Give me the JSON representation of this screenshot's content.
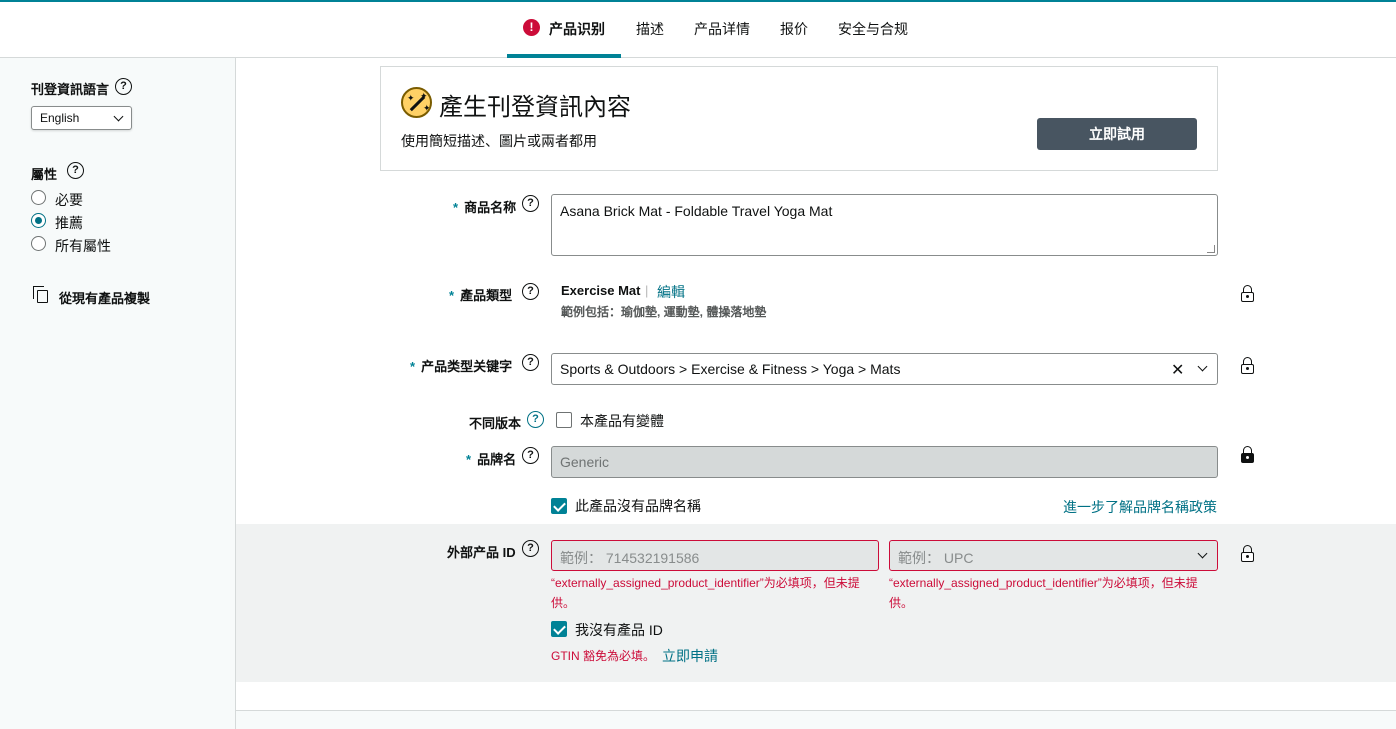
{
  "tabs": {
    "items": [
      {
        "label": "产品识别"
      },
      {
        "label": "描述"
      },
      {
        "label": "产品详情"
      },
      {
        "label": "报价"
      },
      {
        "label": "安全与合规"
      }
    ],
    "error_symbol": "!"
  },
  "sidebar": {
    "language_title": "刊登資訊語言",
    "language_value": "English",
    "attributes_title": "屬性",
    "options": [
      {
        "label": "必要",
        "selected": false
      },
      {
        "label": "推薦",
        "selected": true
      },
      {
        "label": "所有屬性",
        "selected": false
      }
    ],
    "copy_label": "從現有產品複製",
    "help_symbol": "?"
  },
  "generate": {
    "title": "產生刊登資訊內容",
    "subtitle": "使用簡短描述、圖片或兩者都用",
    "button": "立即試用"
  },
  "fields": {
    "required_mark": "*",
    "item_name": {
      "label": "商品名称",
      "value": "Asana Brick Mat - Foldable Travel Yoga Mat"
    },
    "product_type": {
      "label": "產品類型",
      "value": "Exercise Mat",
      "separator": "|",
      "edit": "編輯",
      "examples": "範例包括：瑜伽墊, 運動墊, 體操落地墊"
    },
    "keywords": {
      "label": "产品类型关键字",
      "value": "Sports & Outdoors > Exercise & Fitness > Yoga > Mats",
      "clear": "✕"
    },
    "variations": {
      "label": "不同版本",
      "checkbox_label": "本產品有變體",
      "checked": false
    },
    "brand": {
      "label": "品牌名",
      "placeholder": "Generic",
      "no_brand_label": "此產品沒有品牌名稱",
      "no_brand_checked": true,
      "policy_link": "進一步了解品牌名稱政策"
    },
    "external_id": {
      "label": "外部产品 ID",
      "id_placeholder": "範例： 714532191586",
      "type_placeholder": "範例： UPC",
      "error": "“externally_assigned_product_identifier”为必填项，但未提供。",
      "no_id_label": "我沒有產品 ID",
      "no_id_checked": true,
      "gtin_error": "GTIN 豁免為必填。",
      "apply_link": "立即申請"
    }
  },
  "colors": {
    "accent": "#008296",
    "link": "#007185",
    "error": "#cc0c39",
    "button": "#485561"
  }
}
